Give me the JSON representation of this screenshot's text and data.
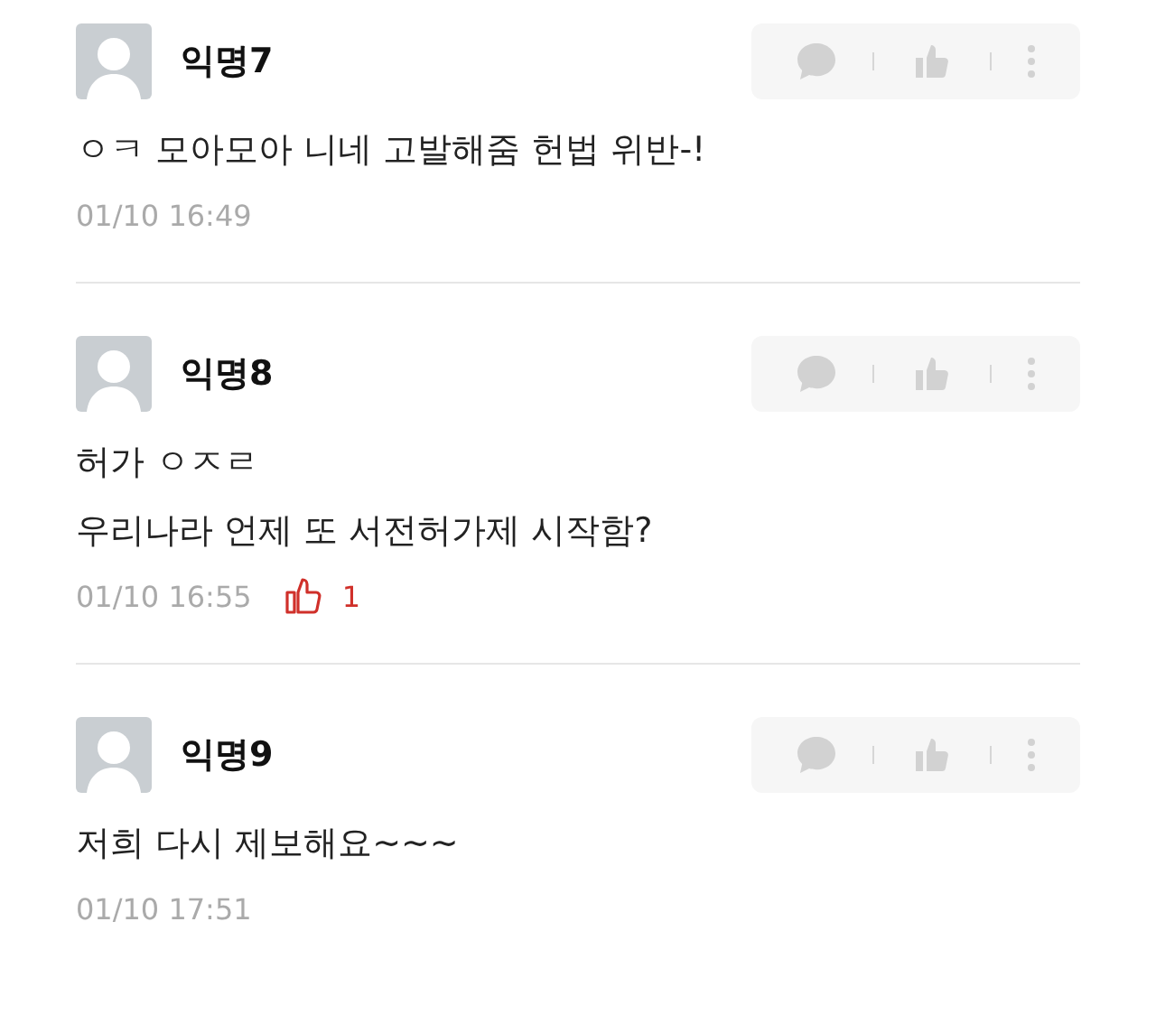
{
  "comments": [
    {
      "author": "익명7",
      "lines": [
        "ㅇㅋ 모아모아 니네 고발해줌 헌법 위반-!"
      ],
      "time": "01/10 16:49"
    },
    {
      "author": "익명8",
      "lines": [
        "허가 ㅇㅈㄹ",
        "우리나라 언제 또 서전허가제 시작함?"
      ],
      "time": "01/10 16:55",
      "likes": "1"
    },
    {
      "author": "익명9",
      "lines": [
        "저희 다시 제보해요~~~"
      ],
      "time": "01/10 17:51"
    }
  ]
}
